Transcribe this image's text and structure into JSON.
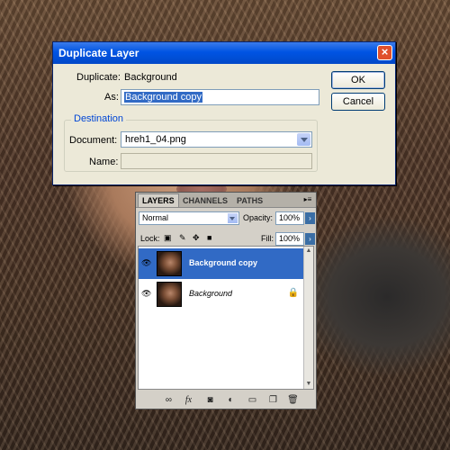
{
  "dialog": {
    "title": "Duplicate Layer",
    "duplicate_label": "Duplicate:",
    "duplicate_value": "Background",
    "as_label": "As:",
    "as_value": "Background copy",
    "ok_label": "OK",
    "cancel_label": "Cancel",
    "destination_label": "Destination",
    "document_label": "Document:",
    "document_value": "hreh1_04.png",
    "name_label": "Name:",
    "name_value": ""
  },
  "layers_panel": {
    "tabs": [
      "LAYERS",
      "CHANNELS",
      "PATHS"
    ],
    "menu_glyph": "▸≡",
    "blend_mode": "Normal",
    "opacity_label": "Opacity:",
    "opacity_value": "100%",
    "lock_label": "Lock:",
    "fill_label": "Fill:",
    "fill_value": "100%",
    "layers": [
      {
        "name": "Background copy",
        "selected": true
      },
      {
        "name": "Background",
        "selected": false
      }
    ]
  },
  "colors": {
    "titlebar": "#0054e3",
    "selection": "#316ac5",
    "dialog_bg": "#ece9d8",
    "group_title": "#0046d5"
  }
}
